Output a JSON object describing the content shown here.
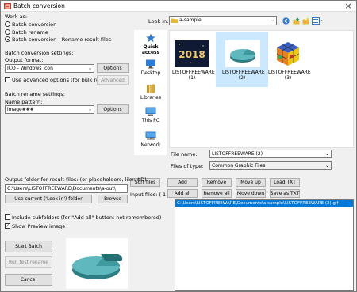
{
  "window": {
    "title": "Batch conversion"
  },
  "work_as": {
    "label": "Work as:",
    "options": [
      "Batch conversion",
      "Batch rename",
      "Batch conversion - Rename result files"
    ],
    "selected_index": 2
  },
  "conversion": {
    "section_label": "Batch conversion settings:",
    "format_label": "Output format:",
    "format_value": "ICO - Windows Icon",
    "options_button": "Options",
    "advanced_check_label": "Use advanced options (for bulk resize...)",
    "advanced_button": "Advanced"
  },
  "rename": {
    "section_label": "Batch rename settings:",
    "pattern_label": "Name pattern:",
    "pattern_value": "image###",
    "options_button": "Options"
  },
  "browser": {
    "look_in_label": "Look in:",
    "look_in_value": "a-sample",
    "places": [
      "Quick access",
      "Desktop",
      "Libraries",
      "This PC",
      "Network"
    ],
    "files": [
      {
        "name": "LISTOFFREEWARE",
        "num": "(1)"
      },
      {
        "name": "LISTOFFREEWARE",
        "num": "(2)"
      },
      {
        "name": "LISTOFFREEWARE",
        "num": "(3)"
      }
    ],
    "thumb1_text": "2018",
    "file_name_label": "File name:",
    "file_name_value": "LISTOFFREEWARE (2)",
    "file_type_label": "Files of type:",
    "file_type_value": "Common Graphic Files"
  },
  "actions": {
    "sort_files": "Sort files",
    "add": "Add",
    "remove": "Remove",
    "move_up": "Move up",
    "load_txt": "Load TXT",
    "add_all": "Add all",
    "remove_all": "Remove all",
    "move_down": "Move down",
    "save_as_txt": "Save as TXT"
  },
  "input_files": {
    "label": "Input files: ( 1 )",
    "items": [
      "C:\\Users\\LISTOFFREEWARE\\Documents\\a sample\\LISTOFFREEWARE (2).gif"
    ]
  },
  "output": {
    "label": "Output folder for result files: (or placeholders, like: $D)",
    "value": "C:\\Users\\LISTOFFREEWARE\\Documents\\a-out\\",
    "use_current_button": "Use current ('Look in') folder",
    "browse_button": "Browse"
  },
  "options": {
    "include_subfolders": "Include subfolders (for \"Add all\" button; not remembered)",
    "show_preview": "Show Preview image"
  },
  "bottom": {
    "start_batch": "Start Batch",
    "run_test_rename": "Run test rename",
    "cancel": "Cancel"
  },
  "colors": {
    "selection": "#0078d7",
    "selected_tile": "#cce8ff",
    "teal": "#3f9aa0"
  }
}
